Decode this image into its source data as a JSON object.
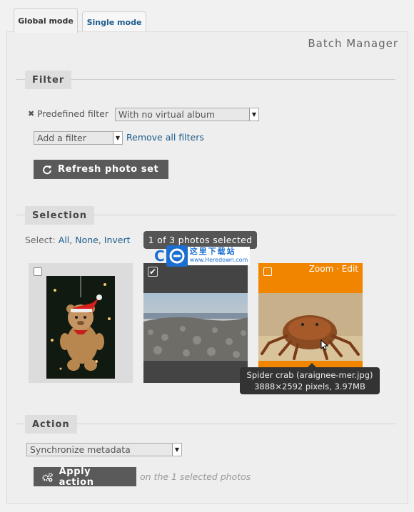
{
  "tabs": [
    {
      "label": "Global mode",
      "active": true
    },
    {
      "label": "Single mode",
      "active": false
    }
  ],
  "page_title": "Batch Manager",
  "filter": {
    "heading": "Filter",
    "predefined_label": "Predefined filter",
    "predefined_value": "With no virtual album",
    "add_filter_value": "Add a filter",
    "remove_all_label": "Remove all filters",
    "refresh_label": "Refresh photo set"
  },
  "selection": {
    "heading": "Selection",
    "select_label": "Select:",
    "all": "All",
    "none": "None",
    "invert": "Invert",
    "counter": "1 of 3 photos selected",
    "zoom": "Zoom",
    "edit": "Edit",
    "separator": "·",
    "photos": [
      {
        "name": "teddy-bear",
        "selected": false
      },
      {
        "name": "rocky-shore",
        "selected": true
      },
      {
        "name": "spider-crab",
        "selected": false
      }
    ],
    "tooltip_line1": "Spider crab (araignee-mer.jpg)",
    "tooltip_line2": "3888×2592 pixels, 3.97MB"
  },
  "action": {
    "heading": "Action",
    "select_value": "Synchronize metadata",
    "apply_label": "Apply action",
    "apply_note": "on the 1 selected photos"
  },
  "watermark": {
    "cn": "这里下载站",
    "url": "www.Heredown.com"
  },
  "colors": {
    "accent": "#f28500",
    "link": "#1d5c8c",
    "button": "#5a5a5a"
  }
}
